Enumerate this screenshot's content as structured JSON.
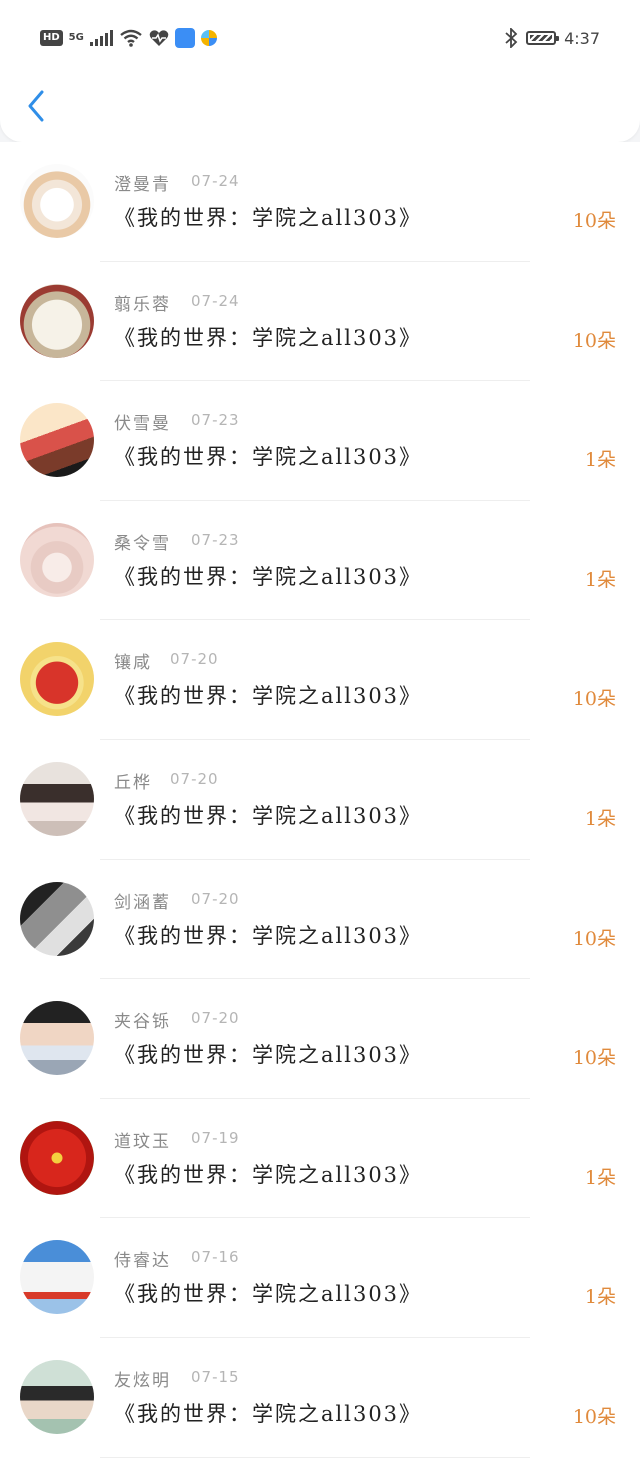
{
  "status_bar": {
    "hd": "HD",
    "network": "5G",
    "time": "4:37",
    "icons": [
      "hd-icon",
      "signal-icon",
      "wifi-icon",
      "heart-rate-icon",
      "app-store-icon",
      "colorful-app-icon",
      "bluetooth-icon",
      "battery-icon"
    ]
  },
  "nav": {
    "back_icon": "chevron-left-icon",
    "accent": "#2f8ee8"
  },
  "colors": {
    "amount": "#e08a3c",
    "name": "#8a8a8a",
    "date": "#b5b5b5"
  },
  "items": [
    {
      "name": "澄曼青",
      "date": "07-24",
      "title": "《我的世界：学院之all303》",
      "amount": "10朵",
      "avatar": "cartoon"
    },
    {
      "name": "翦乐蓉",
      "date": "07-24",
      "title": "《我的世界：学院之all303》",
      "amount": "10朵",
      "avatar": "paper"
    },
    {
      "name": "伏雪曼",
      "date": "07-23",
      "title": "《我的世界：学院之all303》",
      "amount": "1朵",
      "avatar": "couple"
    },
    {
      "name": "桑令雪",
      "date": "07-23",
      "title": "《我的世界：学院之all303》",
      "amount": "1朵",
      "avatar": "cat-paw"
    },
    {
      "name": "镶咸",
      "date": "07-20",
      "title": "《我的世界：学院之all303》",
      "amount": "10朵",
      "avatar": "red-fox"
    },
    {
      "name": "丘桦",
      "date": "07-20",
      "title": "《我的世界：学院之all303》",
      "amount": "1朵",
      "avatar": "girl-art"
    },
    {
      "name": "剑涵蓄",
      "date": "07-20",
      "title": "《我的世界：学院之all303》",
      "amount": "10朵",
      "avatar": "bw-couple"
    },
    {
      "name": "夹谷铄",
      "date": "07-20",
      "title": "《我的世界：学院之all303》",
      "amount": "10朵",
      "avatar": "boy"
    },
    {
      "name": "道玟玉",
      "date": "07-19",
      "title": "《我的世界：学院之all303》",
      "amount": "1朵",
      "avatar": "red-flower"
    },
    {
      "name": "侍睿达",
      "date": "07-16",
      "title": "《我的世界：学院之all303》",
      "amount": "1朵",
      "avatar": "cat-hat"
    },
    {
      "name": "友炫明",
      "date": "07-15",
      "title": "《我的世界：学院之all303》",
      "amount": "10朵",
      "avatar": "woman"
    }
  ]
}
